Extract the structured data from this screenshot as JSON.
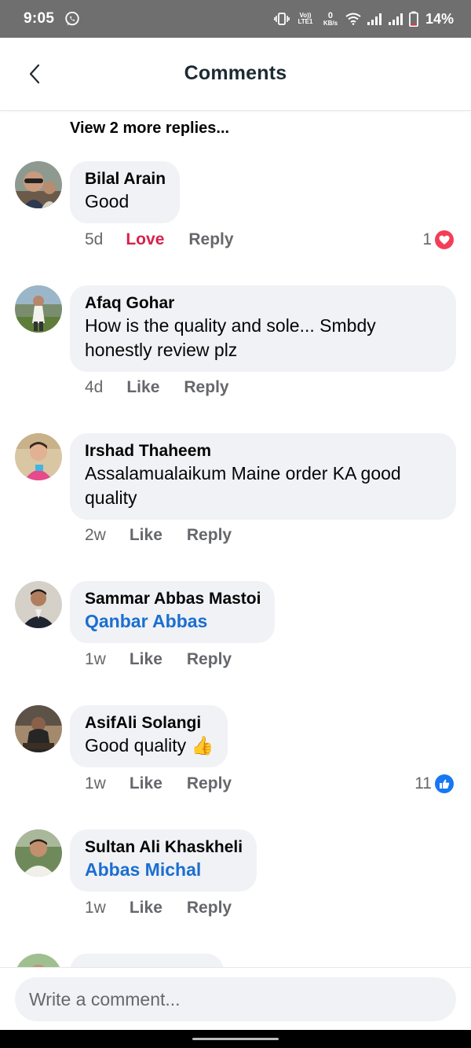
{
  "status_bar": {
    "time": "9:05",
    "volte_label": "Vo)) LTE1",
    "speed_value": "0",
    "speed_unit": "KB/s",
    "battery": "14%"
  },
  "header": {
    "title": "Comments"
  },
  "view_more_replies": "View 2 more replies...",
  "comments": [
    {
      "author": "Bilal Arain",
      "text": "Good",
      "time": "5d",
      "like_label": "Love",
      "reply_label": "Reply",
      "reaction_count": "1",
      "reaction_type": "love",
      "reaction_color": "#f33e58"
    },
    {
      "author": "Afaq Gohar",
      "text": "How is the quality and sole... Smbdy honestly review plz",
      "time": "4d",
      "like_label": "Like",
      "reply_label": "Reply"
    },
    {
      "author": "Irshad Thaheem",
      "text": "Assalamualaikum Maine order KA good quality",
      "time": "2w",
      "like_label": "Like",
      "reply_label": "Reply"
    },
    {
      "author": "Sammar Abbas Mastoi",
      "mention": "Qanbar Abbas",
      "time": "1w",
      "like_label": "Like",
      "reply_label": "Reply"
    },
    {
      "author": "AsifAli Solangi",
      "text": "Good quality 👍",
      "time": "1w",
      "like_label": "Like",
      "reply_label": "Reply",
      "reaction_count": "11",
      "reaction_type": "like",
      "reaction_color": "#1877f2"
    },
    {
      "author": "Sultan Ali Khaskheli",
      "mention": "Abbas Michal",
      "time": "1w",
      "like_label": "Like",
      "reply_label": "Reply"
    }
  ],
  "composer": {
    "placeholder": "Write a comment..."
  },
  "colors": {
    "mention": "#1b6ed1",
    "love": "#d7224a",
    "bubble": "#f0f2f5"
  }
}
